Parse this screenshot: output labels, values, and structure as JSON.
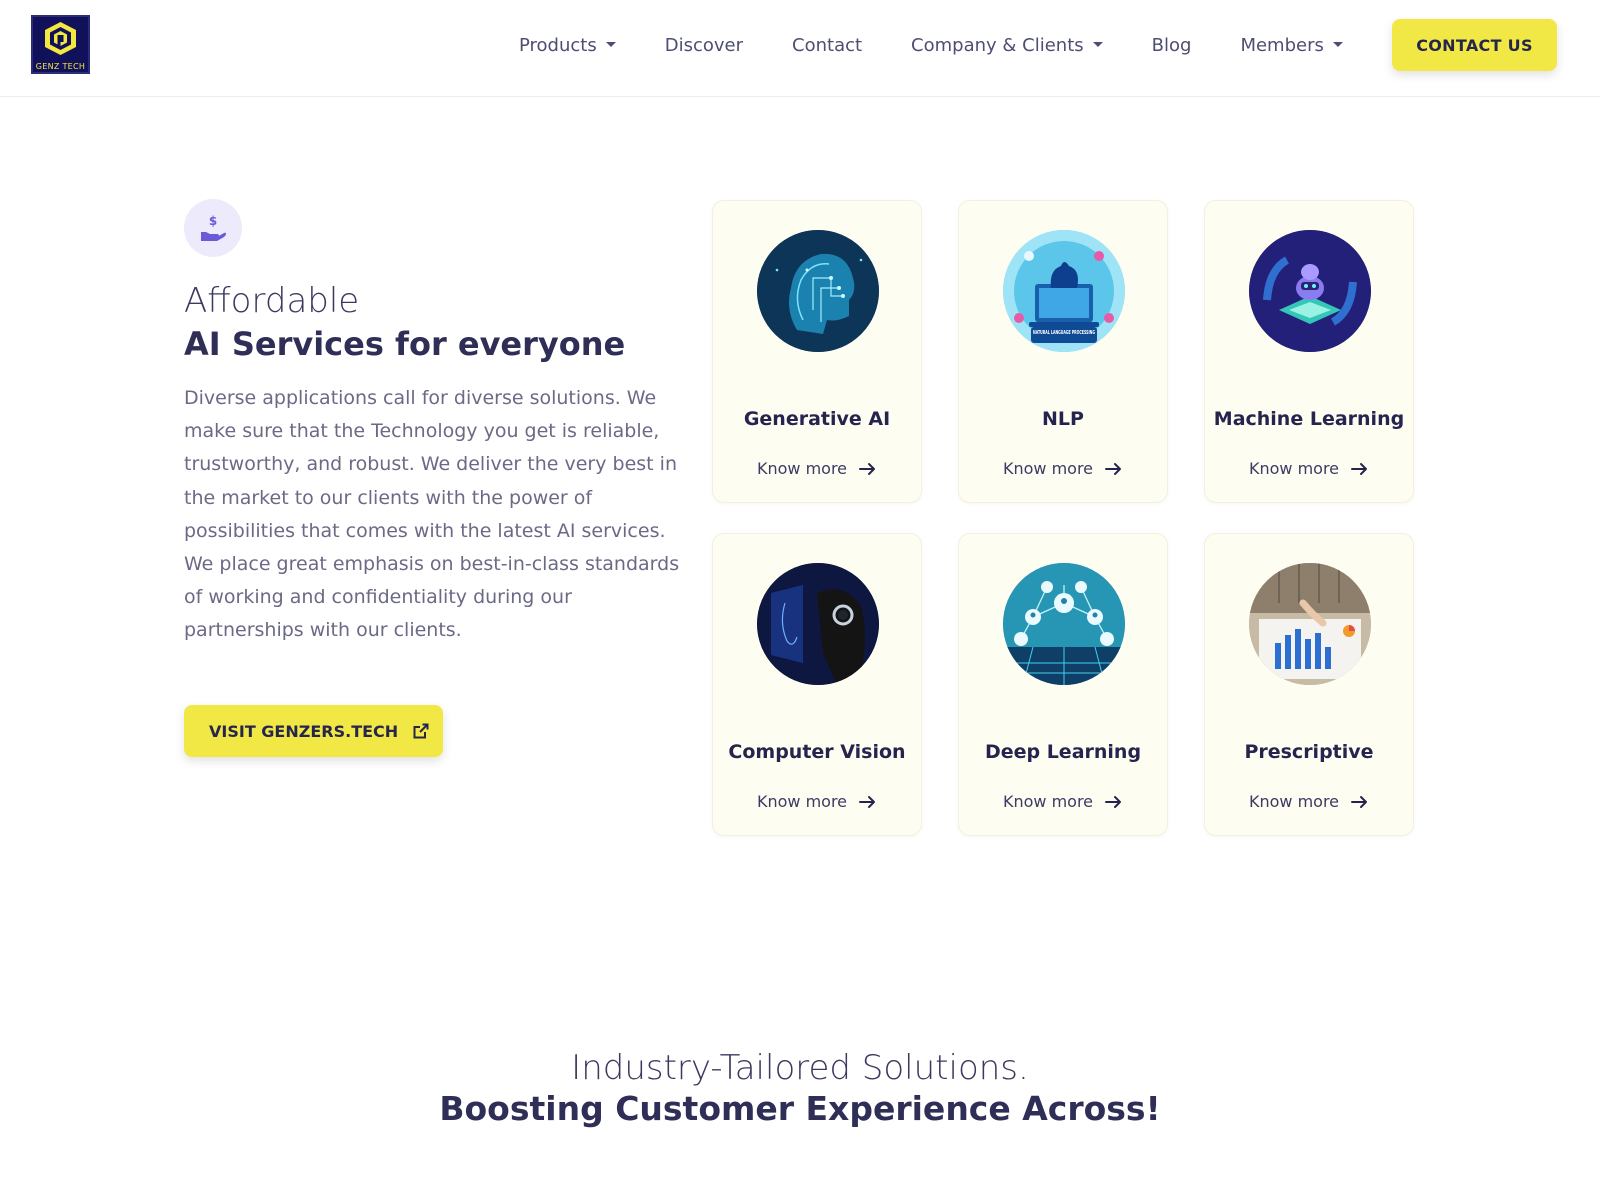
{
  "header": {
    "logo_text": "GENZ TECH",
    "nav": [
      {
        "label": "Products",
        "dropdown": true
      },
      {
        "label": "Discover",
        "dropdown": false
      },
      {
        "label": "Contact",
        "dropdown": false
      },
      {
        "label": "Company & Clients",
        "dropdown": true
      },
      {
        "label": "Blog",
        "dropdown": false
      },
      {
        "label": "Members",
        "dropdown": true
      }
    ],
    "cta_label": "CONTACT US"
  },
  "hero": {
    "badge_icon": "hand-dollar-icon",
    "title_light": "Affordable",
    "title_bold": "AI Services for everyone",
    "description": "Diverse applications call for diverse solutions. We make sure that the Technology you get is reliable, trustworthy, and robust. We deliver the very best in the market to our clients with the power of possibilities that comes with the latest AI services. We place great emphasis on best-in-class standards of working and confidentiality during our partnerships with our clients.",
    "visit_label": "VISIT GENZERS.TECH",
    "visit_icon": "external-link-icon"
  },
  "services": [
    {
      "title": "Generative AI",
      "link": "Know more",
      "image": "ai-head-image"
    },
    {
      "title": "NLP",
      "link": "Know more",
      "image": "nlp-laptop-image",
      "image_caption": "NATURAL LANGUAGE PROCESSING"
    },
    {
      "title": "Machine Learning",
      "link": "Know more",
      "image": "robot-chip-image"
    },
    {
      "title": "Computer Vision",
      "link": "Know more",
      "image": "face-scan-image"
    },
    {
      "title": "Deep Learning",
      "link": "Know more",
      "image": "network-people-image"
    },
    {
      "title": "Prescriptive",
      "link": "Know more",
      "image": "analytics-charts-image"
    }
  ],
  "industry": {
    "title_light": "Industry-Tailored Solutions.",
    "title_bold": "Boosting Customer Experience Across!"
  },
  "colors": {
    "accent_yellow": "#f2e845",
    "navy": "#2f2e57",
    "card_bg": "#fefdf1",
    "badge_bg": "#edeafb"
  }
}
